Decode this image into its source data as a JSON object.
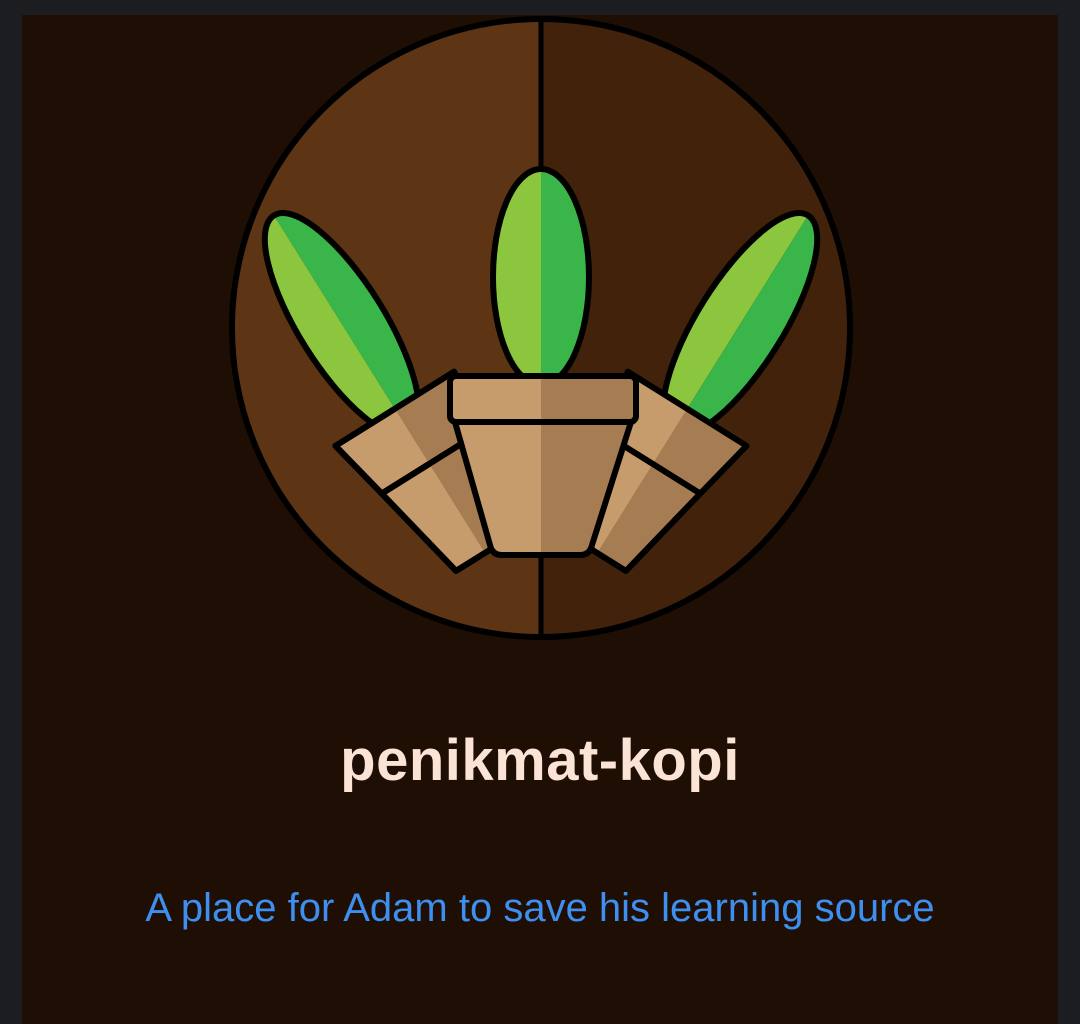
{
  "project": {
    "name": "penikmat-kopi",
    "description": "A place for Adam to save his learning source"
  },
  "logo": {
    "icon": "potted-plants-logo-icon",
    "colors": {
      "left_half": "#5d3515",
      "right_half": "#43220b",
      "leaf_light": "#8cc63f",
      "leaf_dark": "#39b54a",
      "pot_light": "#c69c6d",
      "pot_dark": "#a67c52"
    }
  },
  "colors": {
    "page_background": "#1c1d20",
    "panel_background": "#1f0e04",
    "title": "#fbe3d6",
    "link": "#3d8ff0"
  }
}
